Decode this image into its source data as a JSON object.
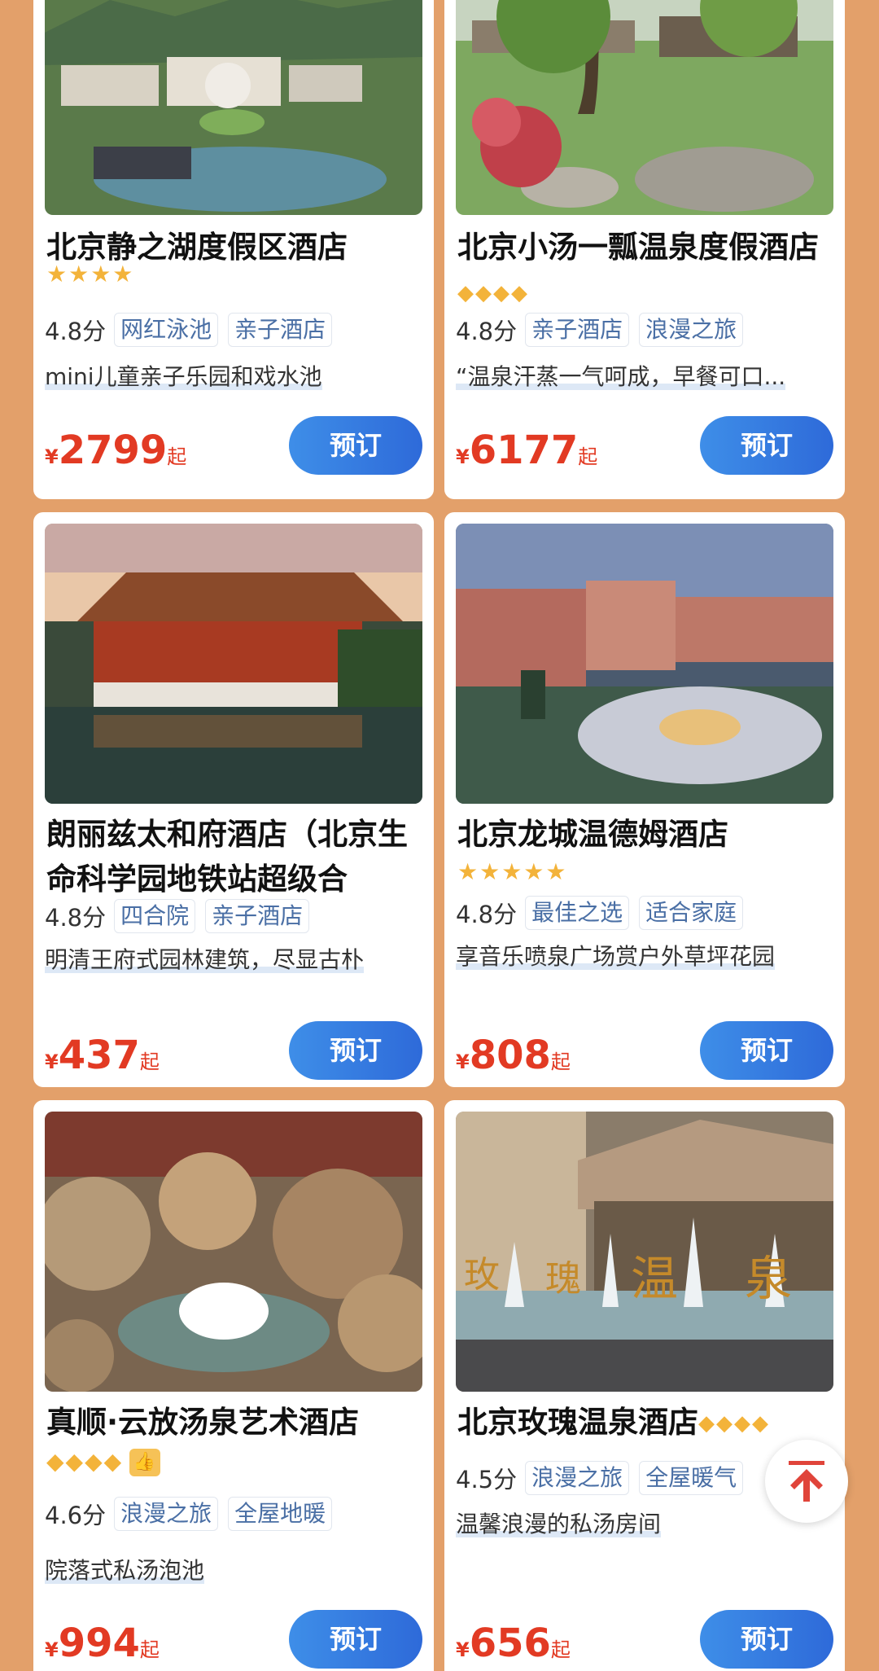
{
  "hotels": [
    {
      "name": "北京静之湖度假区酒店",
      "stars": "★★★★",
      "score": "4.8分",
      "tags": [
        "网红泳池",
        "亲子酒店"
      ],
      "desc": "mini儿童亲子乐园和戏水池",
      "currency": "¥",
      "price": "2799",
      "suffix": "起",
      "book_label": "预订"
    },
    {
      "name": "北京小汤一瓢温泉度假酒店",
      "stars": "◆◆◆◆",
      "score": "4.8分",
      "tags": [
        "亲子酒店",
        "浪漫之旅"
      ],
      "desc": "“温泉汗蒸一气呵成，早餐可口...",
      "currency": "¥",
      "price": "6177",
      "suffix": "起",
      "book_label": "预订"
    },
    {
      "name": "朗丽兹太和府酒店（北京生命科学园地铁站超级合",
      "stars": "",
      "score": "4.8分",
      "tags": [
        "四合院",
        "亲子酒店"
      ],
      "desc": "明清王府式园林建筑，尽显古朴",
      "currency": "¥",
      "price": "437",
      "suffix": "起",
      "book_label": "预订"
    },
    {
      "name": "北京龙城温德姆酒店",
      "stars": "★★★★★",
      "score": "4.8分",
      "tags": [
        "最佳之选",
        "适合家庭"
      ],
      "desc": "享音乐喷泉广场赏户外草坪花园",
      "currency": "¥",
      "price": "808",
      "suffix": "起",
      "book_label": "预订"
    },
    {
      "name": "真顺·云放汤泉艺术酒店",
      "stars": "◆◆◆◆",
      "score": "4.6分",
      "tags": [
        "浪漫之旅",
        "全屋地暖"
      ],
      "desc": "院落式私汤泡池",
      "currency": "¥",
      "price": "994",
      "suffix": "起",
      "book_label": "预订"
    },
    {
      "name": "北京玫瑰温泉酒店",
      "stars": "◆◆◆◆",
      "score": "4.5分",
      "tags": [
        "浪漫之旅",
        "全屋暖气"
      ],
      "desc": "温馨浪漫的私汤房间",
      "currency": "¥",
      "price": "656",
      "suffix": "起",
      "book_label": "预订"
    }
  ],
  "colors": {
    "background": "#e3a06a",
    "price": "#e23a23",
    "button": "#3e8ee8",
    "tag_text": "#4a6fa5",
    "star": "#f3b33a"
  },
  "icons": {
    "back_to_top": "arrow-up-to-top-icon",
    "thumb": "thumbs-up-icon"
  }
}
